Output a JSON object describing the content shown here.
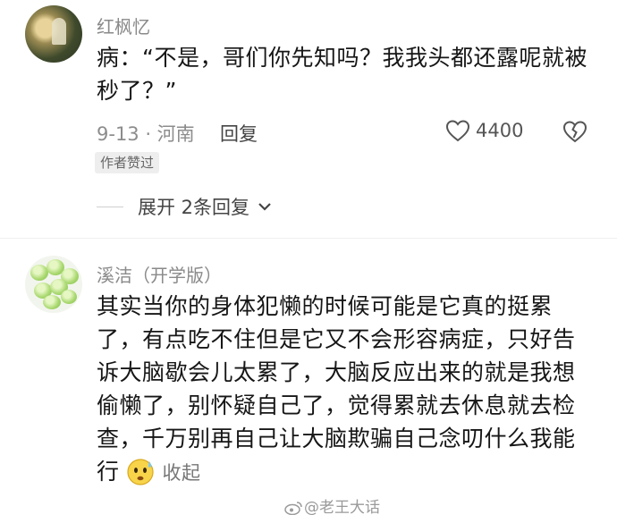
{
  "comments": [
    {
      "username": "红枫忆",
      "text": "病：“不是，哥们你先知吗？我我头都还露呢就被秒了？”",
      "date_location": "9-13 · 河南",
      "reply_label": "回复",
      "like_count": "4400",
      "badge": "作者赞过",
      "expand_label": "展开 2条回复",
      "icons": [
        "avatar",
        "heart-icon",
        "broken-heart-icon",
        "chevron-down-icon"
      ]
    },
    {
      "username": "溪洁（开学版）",
      "text": "其实当你的身体犯懒的时候可能是它真的挺累了，有点吃不住但是它又不会形容病症，只好告诉大脑歇会儿太累了，大脑反应出来的就是我想偷懒了，别怀疑自己了，觉得累就去休息就去检查，千万别再自己让大脑欺骗自己念叨什么我能行",
      "collapse_label": "收起",
      "icons": [
        "avatar",
        "sweat-emoji-icon"
      ]
    }
  ],
  "watermark": "@老王大话",
  "colors": {
    "meta_gray": "#8c8c8c",
    "text": "#161616",
    "badge_bg": "#eeeeee"
  }
}
